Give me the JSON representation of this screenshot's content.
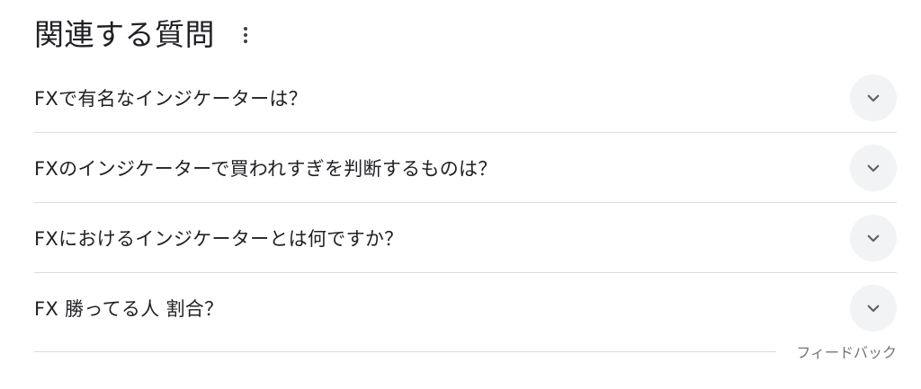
{
  "header": {
    "title": "関連する質問"
  },
  "icons": {
    "more": "more-vert-icon",
    "expand": "chevron-down-icon"
  },
  "questions": [
    {
      "text": "FXで有名なインジケーターは？"
    },
    {
      "text": "FXのインジケーターで買われすぎを判断するものは？"
    },
    {
      "text": "FXにおけるインジケーターとは何ですか？"
    },
    {
      "text": "FX 勝ってる人 割合？"
    }
  ],
  "footer": {
    "feedback_label": "フィードバック"
  },
  "colors": {
    "text": "#202124",
    "divider": "#dadce0",
    "chevron_bg": "#f1f3f4",
    "chevron": "#5f6368",
    "muted": "#70757a"
  }
}
